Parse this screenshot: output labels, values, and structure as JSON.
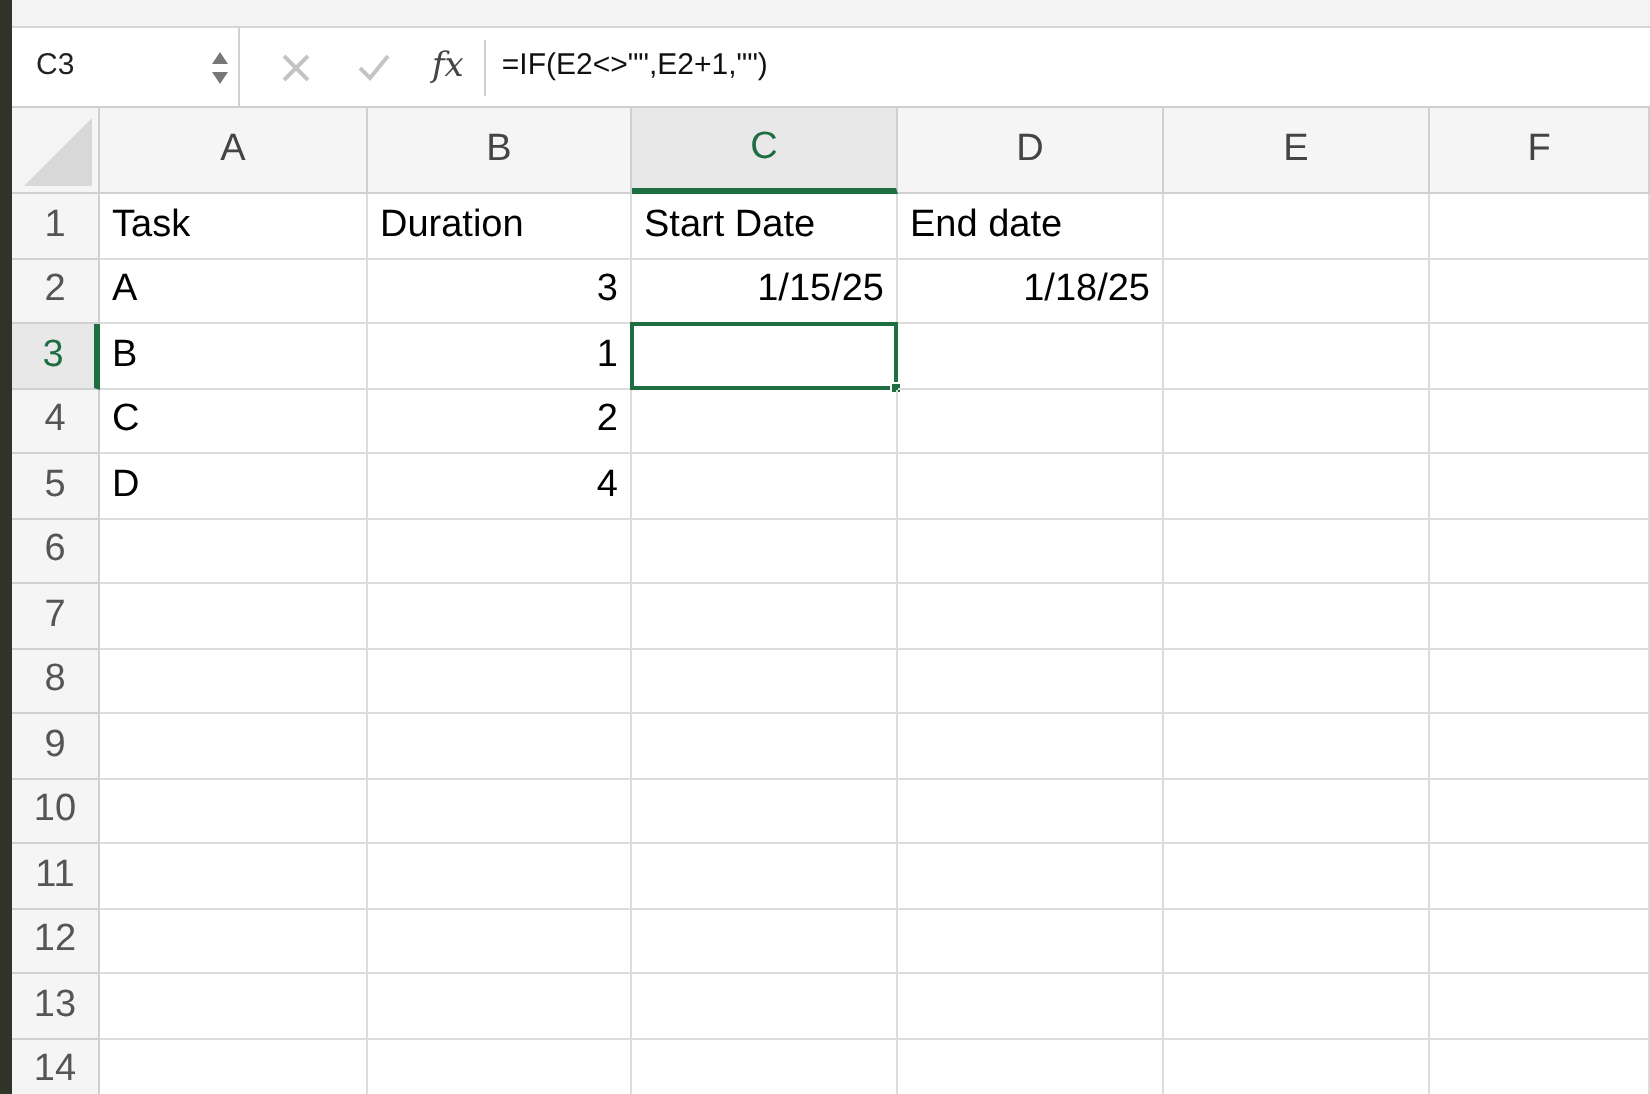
{
  "name_box": {
    "value": "C3"
  },
  "formula_bar": {
    "fx_label": "fx",
    "formula": "=IF(E2<>\"\",E2+1,\"\")"
  },
  "columns": [
    {
      "label": "A",
      "selected": false
    },
    {
      "label": "B",
      "selected": false
    },
    {
      "label": "C",
      "selected": true
    },
    {
      "label": "D",
      "selected": false
    },
    {
      "label": "E",
      "selected": false
    },
    {
      "label": "F",
      "selected": false
    }
  ],
  "rows": [
    {
      "label": "1",
      "selected": false,
      "cells": [
        {
          "kind": "text",
          "text": "Task"
        },
        {
          "kind": "text",
          "text": "Duration"
        },
        {
          "kind": "text",
          "text": "Start Date"
        },
        {
          "kind": "text",
          "text": "End date"
        }
      ]
    },
    {
      "label": "2",
      "selected": false,
      "cells": [
        {
          "kind": "text",
          "text": "A"
        },
        {
          "kind": "number",
          "text": "3"
        },
        {
          "kind": "number",
          "text": "1/15/25"
        },
        {
          "kind": "number",
          "text": "1/18/25"
        }
      ]
    },
    {
      "label": "3",
      "selected": true,
      "cells": [
        {
          "kind": "text",
          "text": "B"
        },
        {
          "kind": "number",
          "text": "1"
        }
      ]
    },
    {
      "label": "4",
      "selected": false,
      "cells": [
        {
          "kind": "text",
          "text": "C"
        },
        {
          "kind": "number",
          "text": "2"
        }
      ]
    },
    {
      "label": "5",
      "selected": false,
      "cells": [
        {
          "kind": "text",
          "text": "D"
        },
        {
          "kind": "number",
          "text": "4"
        }
      ]
    },
    {
      "label": "6",
      "selected": false,
      "cells": []
    },
    {
      "label": "7",
      "selected": false,
      "cells": []
    },
    {
      "label": "8",
      "selected": false,
      "cells": []
    },
    {
      "label": "9",
      "selected": false,
      "cells": []
    },
    {
      "label": "10",
      "selected": false,
      "cells": []
    },
    {
      "label": "11",
      "selected": false,
      "cells": []
    },
    {
      "label": "12",
      "selected": false,
      "cells": []
    },
    {
      "label": "13",
      "selected": false,
      "cells": []
    },
    {
      "label": "14",
      "selected": false,
      "cells": []
    }
  ]
}
